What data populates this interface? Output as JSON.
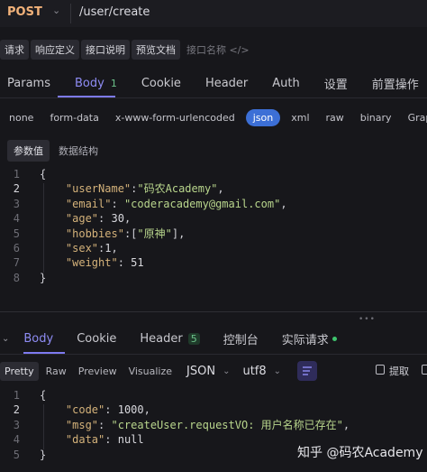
{
  "request": {
    "method": "POST",
    "url": "/user/create"
  },
  "doc_tabs": [
    "请求",
    "响应定义",
    "接口说明",
    "预览文档",
    "接口名称 </>"
  ],
  "main_tabs": [
    {
      "label": "Params"
    },
    {
      "label": "Body",
      "badge": "1"
    },
    {
      "label": "Cookie"
    },
    {
      "label": "Header"
    },
    {
      "label": "Auth"
    },
    {
      "label": "设置"
    },
    {
      "label": "前置操作"
    }
  ],
  "body_types": [
    "none",
    "form-data",
    "x-www-form-urlencoded",
    "json",
    "xml",
    "raw",
    "binary",
    "Graph"
  ],
  "body_subtabs": [
    "参数值",
    "数据结构"
  ],
  "request_code": [
    {
      "n": "1",
      "t": [
        [
          "p",
          "{"
        ]
      ]
    },
    {
      "n": "2",
      "t": [
        [
          "p",
          "    "
        ],
        [
          "k",
          "\"userName\""
        ],
        [
          "p",
          ":"
        ],
        [
          "s",
          "\"码农Academy\""
        ],
        [
          "p",
          ","
        ]
      ]
    },
    {
      "n": "3",
      "t": [
        [
          "p",
          "    "
        ],
        [
          "k",
          "\"email\""
        ],
        [
          "p",
          ": "
        ],
        [
          "s",
          "\"coderacademy@gmail.com\""
        ],
        [
          "p",
          ","
        ]
      ]
    },
    {
      "n": "4",
      "t": [
        [
          "p",
          "    "
        ],
        [
          "k",
          "\"age\""
        ],
        [
          "p",
          ": "
        ],
        [
          "n",
          "30"
        ],
        [
          "p",
          ","
        ]
      ]
    },
    {
      "n": "5",
      "t": [
        [
          "p",
          "    "
        ],
        [
          "k",
          "\"hobbies\""
        ],
        [
          "p",
          ":["
        ],
        [
          "s",
          "\"原神\""
        ],
        [
          "p",
          "],"
        ]
      ]
    },
    {
      "n": "6",
      "t": [
        [
          "p",
          "    "
        ],
        [
          "k",
          "\"sex\""
        ],
        [
          "p",
          ":"
        ],
        [
          "n",
          "1"
        ],
        [
          "p",
          ","
        ]
      ]
    },
    {
      "n": "7",
      "t": [
        [
          "p",
          "    "
        ],
        [
          "k",
          "\"weight\""
        ],
        [
          "p",
          ": "
        ],
        [
          "n",
          "51"
        ]
      ]
    },
    {
      "n": "8",
      "t": [
        [
          "p",
          "}"
        ]
      ]
    }
  ],
  "response_tabs": [
    {
      "label": "Body"
    },
    {
      "label": "Cookie"
    },
    {
      "label": "Header",
      "badge": "5"
    },
    {
      "label": "控制台"
    },
    {
      "label": "实际请求"
    }
  ],
  "response_views": [
    "Pretty",
    "Raw",
    "Preview",
    "Visualize"
  ],
  "response_format": "JSON",
  "response_encoding": "utf8",
  "extract_label": "提取",
  "response_code": [
    {
      "n": "1",
      "t": [
        [
          "p",
          "{"
        ]
      ]
    },
    {
      "n": "2",
      "t": [
        [
          "p",
          "    "
        ],
        [
          "k",
          "\"code\""
        ],
        [
          "p",
          ": "
        ],
        [
          "n",
          "1000"
        ],
        [
          "p",
          ","
        ]
      ]
    },
    {
      "n": "3",
      "t": [
        [
          "p",
          "    "
        ],
        [
          "k",
          "\"msg\""
        ],
        [
          "p",
          ": "
        ],
        [
          "s",
          "\"createUser.requestVO: 用户名称已存在\""
        ],
        [
          "p",
          ","
        ]
      ]
    },
    {
      "n": "4",
      "t": [
        [
          "p",
          "    "
        ],
        [
          "k",
          "\"data\""
        ],
        [
          "p",
          ": "
        ],
        [
          "n",
          "null"
        ]
      ]
    },
    {
      "n": "5",
      "t": [
        [
          "p",
          "}"
        ]
      ]
    }
  ],
  "watermark": "知乎 @码农Academy",
  "colors": {
    "accent": "#7d7af0",
    "json_active": "#3c6fd6",
    "method": "#f2b27a",
    "key": "#d4b27a",
    "string": "#b8d58c",
    "status_dot": "#3ec46d"
  }
}
